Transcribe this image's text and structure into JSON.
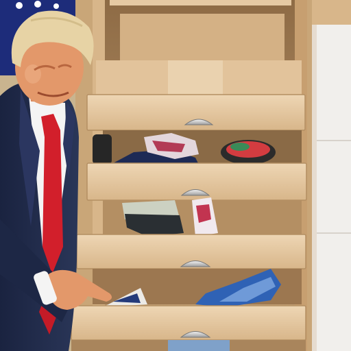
{
  "scene": {
    "kind": "photo",
    "subjects": [
      "person",
      "wooden-drawer-cabinet"
    ],
    "colors": {
      "wood_light": "#e6c9a3",
      "wood_mid": "#d2ae82",
      "wood_dark": "#a9855c",
      "suit": "#1f2a4a",
      "tie": "#d21f2b",
      "shirt": "#f4f4f4",
      "hair": "#e7d3a5",
      "skin": "#e3986a",
      "flag_blue": "#1d2c7a",
      "wall_white": "#f1efec"
    },
    "drawer_count": 4,
    "handle_icon": "drawer-pull-icon"
  }
}
